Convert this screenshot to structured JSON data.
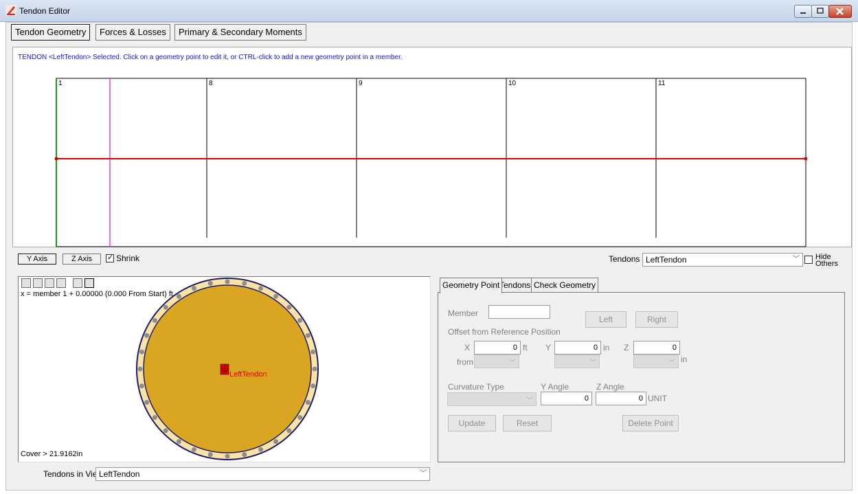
{
  "window": {
    "title": "Tendon Editor"
  },
  "tabs": [
    "Tendon Geometry",
    "Forces & Losses",
    "Primary & Secondary Moments"
  ],
  "status_message": "TENDON <LeftTendon> Selected.  Click on a geometry point to edit it, or CTRL-click to add a new geometry point in a member.",
  "elevation": {
    "member_labels": [
      "1",
      "8",
      "9",
      "10",
      "11"
    ]
  },
  "axis_buttons": {
    "y": "Y Axis",
    "z": "Z Axis"
  },
  "shrink": {
    "label": "Shrink",
    "checked": true
  },
  "tendons_selector": {
    "label": "Tendons",
    "value": "LeftTendon"
  },
  "hide_others": {
    "label_line1": "Hide",
    "label_line2": "Others",
    "checked": false
  },
  "section_view": {
    "coord_text": "x = member 1 + 0.00000 (0.000 From Start) ft",
    "tendon_label": "LeftTendon",
    "cover_text": "Cover > 21.9162in"
  },
  "tendons_in_view": {
    "label": "Tendons in View",
    "value": "LeftTendon"
  },
  "sub_tabs": [
    "Geometry Point",
    "Tendons",
    "Check Geometry"
  ],
  "geometry_point": {
    "member_label": "Member",
    "member_value": "",
    "left_button": "Left",
    "right_button": "Right",
    "offset_label": "Offset from Reference Position",
    "x_label": "X",
    "x_value": "0",
    "x_unit": "ft",
    "y_label": "Y",
    "y_value": "0",
    "y_unit": "in",
    "z_label": "Z",
    "z_value": "0",
    "z_unit": "in",
    "from_label": "from",
    "curvature_label": "Curvature Type",
    "y_angle_label": "Y Angle",
    "y_angle_value": "0",
    "z_angle_label": "Z Angle",
    "z_angle_value": "0",
    "angle_unit": "UNIT",
    "update_button": "Update",
    "reset_button": "Reset",
    "delete_button": "Delete Point"
  },
  "colors": {
    "tendon_line": "#e00000",
    "section_fill": "#daa520",
    "status_text": "#1414d8"
  }
}
